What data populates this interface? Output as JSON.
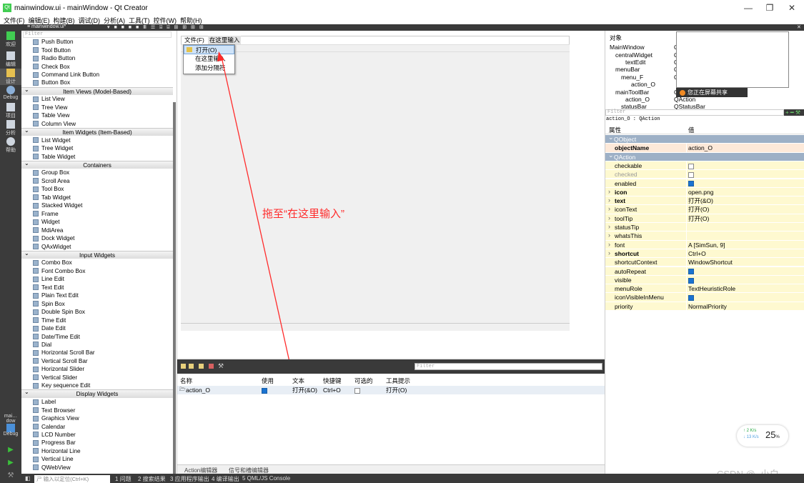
{
  "titlebar": {
    "title": "mainwindow.ui - mainWindow - Qt Creator",
    "qt": "Qt",
    "minimize": "—",
    "maximize": "❐",
    "close": "✕"
  },
  "menubar": [
    "文件(F)",
    "编辑(E)",
    "构建(B)",
    "调试(D)",
    "分析(A)",
    "工具(T)",
    "控件(W)",
    "帮助(H)"
  ],
  "modes": [
    {
      "label": "欢迎"
    },
    {
      "label": "编辑"
    },
    {
      "label": "设计"
    },
    {
      "label": "Debug"
    },
    {
      "label": "项目"
    },
    {
      "label": "分析"
    },
    {
      "label": "帮助"
    }
  ],
  "bottom_modes": {
    "target": "mai…dow",
    "debug": "Debug"
  },
  "editor_tab": "≡ mainwindow.ui*",
  "widgetbox": {
    "filter_placeholder": "Filter",
    "items": [
      {
        "t": "item",
        "label": "Push Button"
      },
      {
        "t": "item",
        "label": "Tool Button"
      },
      {
        "t": "item",
        "label": "Radio Button"
      },
      {
        "t": "item",
        "label": "Check Box"
      },
      {
        "t": "item",
        "label": "Command Link Button"
      },
      {
        "t": "item",
        "label": "Button Box"
      },
      {
        "t": "cat",
        "label": "Item Views (Model-Based)"
      },
      {
        "t": "item",
        "label": "List View"
      },
      {
        "t": "item",
        "label": "Tree View"
      },
      {
        "t": "item",
        "label": "Table View"
      },
      {
        "t": "item",
        "label": "Column View"
      },
      {
        "t": "cat",
        "label": "Item Widgets (Item-Based)"
      },
      {
        "t": "item",
        "label": "List Widget"
      },
      {
        "t": "item",
        "label": "Tree Widget"
      },
      {
        "t": "item",
        "label": "Table Widget"
      },
      {
        "t": "cat",
        "label": "Containers"
      },
      {
        "t": "item",
        "label": "Group Box"
      },
      {
        "t": "item",
        "label": "Scroll Area"
      },
      {
        "t": "item",
        "label": "Tool Box"
      },
      {
        "t": "item",
        "label": "Tab Widget"
      },
      {
        "t": "item",
        "label": "Stacked Widget"
      },
      {
        "t": "item",
        "label": "Frame"
      },
      {
        "t": "item",
        "label": "Widget"
      },
      {
        "t": "item",
        "label": "MdiArea"
      },
      {
        "t": "item",
        "label": "Dock Widget"
      },
      {
        "t": "item",
        "label": "QAxWidget"
      },
      {
        "t": "cat",
        "label": "Input Widgets"
      },
      {
        "t": "item",
        "label": "Combo Box"
      },
      {
        "t": "item",
        "label": "Font Combo Box"
      },
      {
        "t": "item",
        "label": "Line Edit"
      },
      {
        "t": "item",
        "label": "Text Edit"
      },
      {
        "t": "item",
        "label": "Plain Text Edit"
      },
      {
        "t": "item",
        "label": "Spin Box"
      },
      {
        "t": "item",
        "label": "Double Spin Box"
      },
      {
        "t": "item",
        "label": "Time Edit"
      },
      {
        "t": "item",
        "label": "Date Edit"
      },
      {
        "t": "item",
        "label": "Date/Time Edit"
      },
      {
        "t": "item",
        "label": "Dial"
      },
      {
        "t": "item",
        "label": "Horizontal Scroll Bar"
      },
      {
        "t": "item",
        "label": "Vertical Scroll Bar"
      },
      {
        "t": "item",
        "label": "Horizontal Slider"
      },
      {
        "t": "item",
        "label": "Vertical Slider"
      },
      {
        "t": "item",
        "label": "Key sequence Edit"
      },
      {
        "t": "cat",
        "label": "Display Widgets"
      },
      {
        "t": "item",
        "label": "Label"
      },
      {
        "t": "item",
        "label": "Text Browser"
      },
      {
        "t": "item",
        "label": "Graphics View"
      },
      {
        "t": "item",
        "label": "Calendar"
      },
      {
        "t": "item",
        "label": "LCD Number"
      },
      {
        "t": "item",
        "label": "Progress Bar"
      },
      {
        "t": "item",
        "label": "Horizontal Line"
      },
      {
        "t": "item",
        "label": "Vertical Line"
      },
      {
        "t": "item",
        "label": "QWebView"
      }
    ]
  },
  "form": {
    "menu_file": "文件(F)",
    "menu_placeholder": "在这里输入",
    "popup": [
      "打开(O)",
      "在这里输入",
      "添加分隔符"
    ]
  },
  "annotation": "拖至“在这里输入”",
  "action_editor": {
    "filter_placeholder": "Filter",
    "headers": [
      "名称",
      "使用",
      "文本",
      "快捷键",
      "可选的",
      "工具提示"
    ],
    "row": {
      "name": "action_O",
      "used": true,
      "text": "打开(&O)",
      "shortcut": "Ctrl+O",
      "checkable": false,
      "tooltip": "打开(O)"
    },
    "tabs": [
      "Action编辑器",
      "信号和槽编辑器"
    ]
  },
  "object_inspector": {
    "header": "对象",
    "rows": [
      {
        "label": "MainWindow",
        "class": "Q"
      },
      {
        "label": "centralWidget",
        "class": "Q"
      },
      {
        "label": "textEdit",
        "class": "Q"
      },
      {
        "label": "menuBar",
        "class": "Q"
      },
      {
        "label": "menu_F",
        "class": "Q"
      },
      {
        "label": "action_O",
        "class": ""
      },
      {
        "label": "mainToolBar",
        "class": "Q"
      },
      {
        "label": "action_O",
        "class": "QAction"
      },
      {
        "label": "statusBar",
        "class": "QStatusBar"
      }
    ]
  },
  "screen_share": "您正在屏幕共享",
  "property_editor": {
    "filter_placeholder": "Filter",
    "object_line": "action_O : QAction",
    "col_property": "属性",
    "col_value": "值",
    "rows": [
      {
        "k": "QObject",
        "v": "",
        "g": true
      },
      {
        "k": "objectName",
        "v": "action_O",
        "b": true,
        "c": "#fde9d9"
      },
      {
        "k": "QAction",
        "v": "",
        "g": true
      },
      {
        "k": "checkable",
        "v": "",
        "chk": false,
        "c": "#fef9d0"
      },
      {
        "k": "checked",
        "v": "",
        "chk": false,
        "c": "#fef9d0",
        "dim": true
      },
      {
        "k": "enabled",
        "v": "",
        "chk": true,
        "c": "#fef9d0"
      },
      {
        "k": "icon",
        "v": "open.png",
        "b": true,
        "e": true,
        "c": "#fef9d0"
      },
      {
        "k": "text",
        "v": "打开(&O)",
        "b": true,
        "e": true,
        "c": "#fef9d0"
      },
      {
        "k": "iconText",
        "v": "打开(O)",
        "e": true,
        "c": "#fef9d0"
      },
      {
        "k": "toolTip",
        "v": "打开(O)",
        "e": true,
        "c": "#fef9d0"
      },
      {
        "k": "statusTip",
        "v": "",
        "e": true,
        "c": "#fef9d0"
      },
      {
        "k": "whatsThis",
        "v": "",
        "e": true,
        "c": "#fef9d0"
      },
      {
        "k": "font",
        "v": "A  [SimSun, 9]",
        "e": true,
        "c": "#fef9d0"
      },
      {
        "k": "shortcut",
        "v": "Ctrl+O",
        "b": true,
        "e": true,
        "c": "#fef9d0"
      },
      {
        "k": "shortcutContext",
        "v": "WindowShortcut",
        "c": "#fef9d0"
      },
      {
        "k": "autoRepeat",
        "v": "",
        "chk": true,
        "c": "#fef9d0"
      },
      {
        "k": "visible",
        "v": "",
        "chk": true,
        "c": "#fef9d0"
      },
      {
        "k": "menuRole",
        "v": "TextHeuristicRole",
        "c": "#fef9d0"
      },
      {
        "k": "iconVisibleInMenu",
        "v": "",
        "chk": true,
        "c": "#fef9d0"
      },
      {
        "k": "priority",
        "v": "NormalPriority",
        "c": "#fef9d0"
      }
    ]
  },
  "speed_widget": {
    "up": "↑ 2  K/s",
    "down": "↓ 13  K/s",
    "percent": "25",
    "unit": "%"
  },
  "watermark": "CSDN @_小白__",
  "statusbar": {
    "locator": "ㄕ 输入以定位(Ctrl+K)",
    "tabs": [
      "1 问题",
      "2 搜索结果",
      "3 应用程序输出",
      "4 编译输出",
      "5 QML/JS Console"
    ]
  }
}
